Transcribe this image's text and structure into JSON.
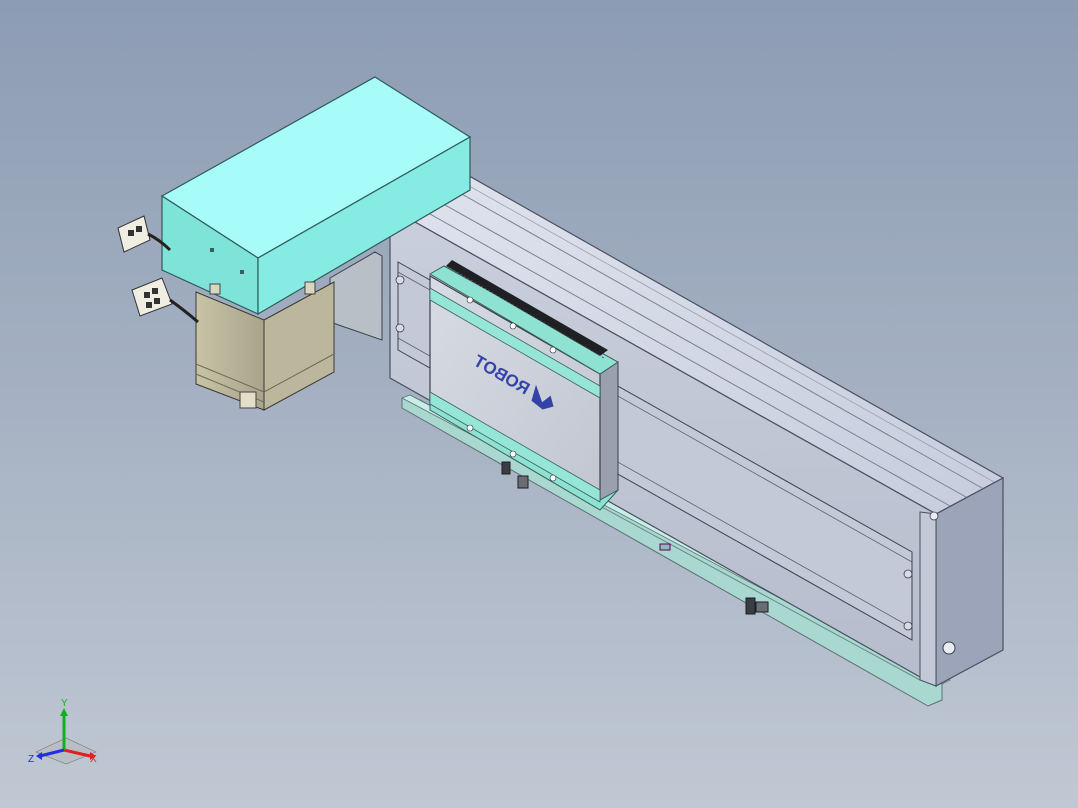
{
  "model": {
    "logo_text": "ROBOT",
    "logo_mark": "robot-arm-logo-icon"
  },
  "triad": {
    "x_label": "X",
    "y_label": "Y",
    "z_label": "Z"
  },
  "colors": {
    "background_top": "#8c9cb4",
    "background_bottom": "#c0c8d3",
    "motor_cover": "#8ff2ee",
    "rail_body": "#c4cad9",
    "carriage": "#c9ced8",
    "accent_strip": "#8ee2d2",
    "logo": "#3543a8",
    "axis_x": "#e02020",
    "axis_y": "#10b020",
    "axis_z": "#2030e0"
  }
}
